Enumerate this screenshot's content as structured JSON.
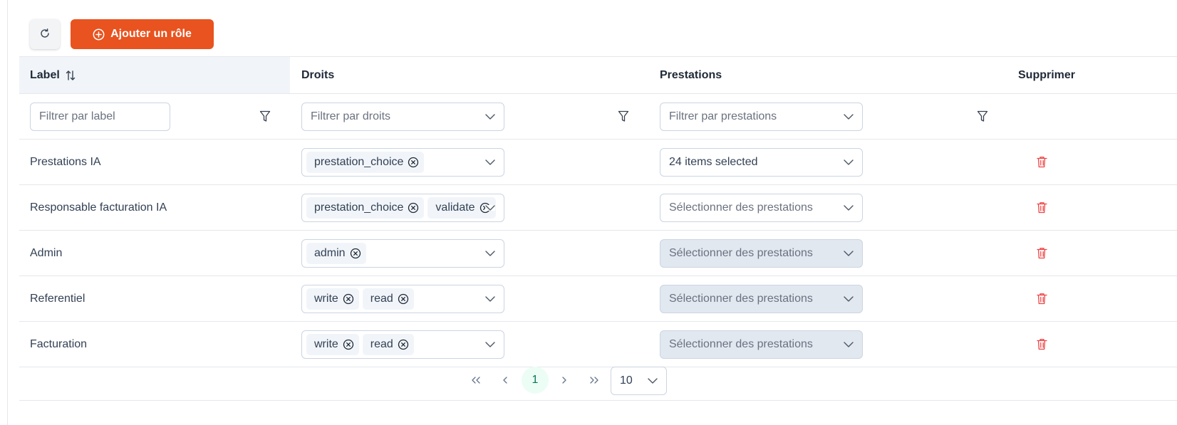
{
  "toolbar": {
    "refresh_icon": "refresh-icon",
    "add_label": "Ajouter un rôle",
    "add_icon": "plus-circle-icon",
    "accent": "#e8531f"
  },
  "table": {
    "columns": {
      "label": "Label",
      "droits": "Droits",
      "prestations": "Prestations",
      "supprimer": "Supprimer"
    },
    "filters": {
      "label_placeholder": "Filtrer par label",
      "droits_placeholder": "Filtrer par droits",
      "prestations_placeholder": "Filtrer par prestations"
    },
    "rows": [
      {
        "label": "Prestations IA",
        "droits": [
          "prestation_choice"
        ],
        "prestations": "24 items selected",
        "prestations_disabled": false
      },
      {
        "label": "Responsable facturation IA",
        "droits": [
          "prestation_choice",
          "validate"
        ],
        "prestations": "Sélectionner des prestations",
        "prestations_disabled": false
      },
      {
        "label": "Admin",
        "droits": [
          "admin"
        ],
        "prestations": "Sélectionner des prestations",
        "prestations_disabled": true
      },
      {
        "label": "Referentiel",
        "droits": [
          "write",
          "read"
        ],
        "prestations": "Sélectionner des prestations",
        "prestations_disabled": true
      },
      {
        "label": "Facturation",
        "droits": [
          "write",
          "read"
        ],
        "prestations": "Sélectionner des prestations",
        "prestations_disabled": true
      }
    ]
  },
  "pagination": {
    "current_page": "1",
    "rows_per_page": "10"
  }
}
